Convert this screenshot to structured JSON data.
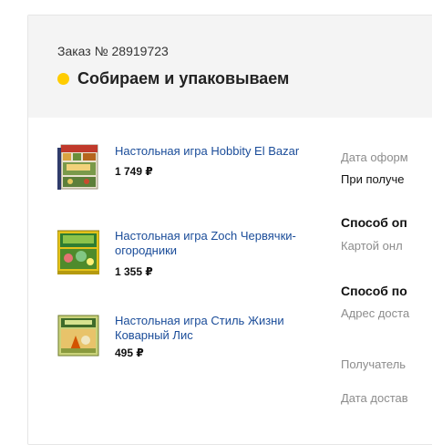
{
  "order": {
    "number_text": "Заказ № 28919723",
    "status_text": "Собираем и упаковываем",
    "status_color": "#ffcc00"
  },
  "items": [
    {
      "title": "Настольная игра Hobbity El Bazar",
      "price": "1 749 ₽"
    },
    {
      "title": "Настольная игра Zoch Червячки-огородники",
      "price": "1 355 ₽"
    },
    {
      "title": "Настольная игра Стиль Жизни Коварный Лис",
      "price": "495 ₽"
    }
  ],
  "details": {
    "date_label": "Дата оформ",
    "date_value": "При получе",
    "payment_heading": "Способ оп",
    "payment_value": "Картой онл",
    "delivery_heading": "Способ по",
    "address_label": "Адрес доста",
    "recipient_label": "Получатель",
    "delivery_date_label": "Дата достав"
  },
  "colors": {
    "link": "#1a4c99",
    "header_bg": "#f4f4f4",
    "muted": "#8c8c8c"
  }
}
